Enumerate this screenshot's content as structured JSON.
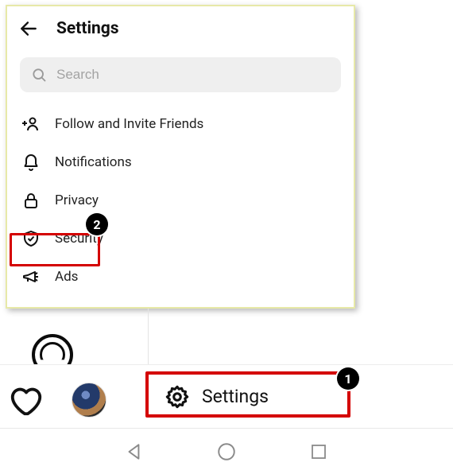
{
  "panel": {
    "title": "Settings",
    "search_placeholder": "Search",
    "items": [
      {
        "label": "Follow and Invite Friends"
      },
      {
        "label": "Notifications"
      },
      {
        "label": "Privacy"
      },
      {
        "label": "Security"
      },
      {
        "label": "Ads"
      }
    ]
  },
  "bottom": {
    "settings_label": "Settings"
  },
  "annotations": {
    "step1": "1",
    "step2": "2"
  }
}
